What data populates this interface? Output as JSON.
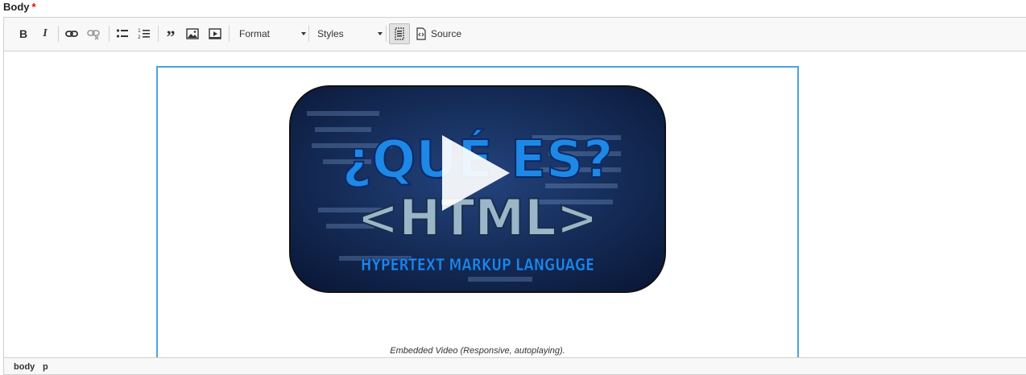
{
  "field": {
    "label": "Body",
    "required_mark": "*"
  },
  "toolbar": {
    "buttons": [
      "bold-icon",
      "italic-icon",
      "link-icon",
      "unlink-icon",
      "bulleted-list-icon",
      "numbered-list-icon",
      "blockquote-icon",
      "image-icon",
      "video-embed-icon",
      "show-blocks-icon",
      "source-icon"
    ],
    "format_label": "Format",
    "styles_label": "Styles",
    "source_label": "Source"
  },
  "content": {
    "video_thumbnail": {
      "title_line1": "¿QUÉ ES?",
      "title_line2": "<HTML>",
      "subtitle": "HYPERTEXT MARKUP LANGUAGE"
    },
    "caption": "Embedded Video (Responsive, autoplaying)."
  },
  "statusbar": {
    "path": [
      "body",
      "p"
    ]
  },
  "colors": {
    "accent_border": "#4ea1e0",
    "required": "#ee0000",
    "thumb_bg": "#0e1f47"
  }
}
